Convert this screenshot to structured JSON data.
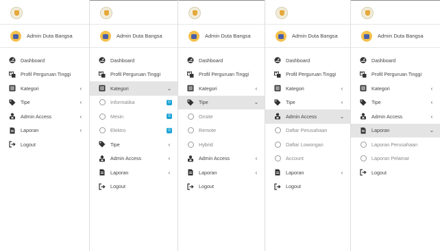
{
  "user": {
    "name": "Admin Duta Bangsa"
  },
  "labels": {
    "dashboard": "Dashboard",
    "profil": "Profil Perguruan Tinggi",
    "kategori": "Kategori",
    "tipe": "Tipe",
    "admin_access": "Admin Access",
    "laporan": "Laporan",
    "logout": "Logout",
    "informatika": "Informatika",
    "mesin": "Mesin",
    "elektro": "Elektro",
    "onsite": "Onsite",
    "remote": "Remote",
    "hybrid": "Hybrid",
    "daftar_perusahaan": "Daftar Perusahaan",
    "daftar_lowongan": "Daftar Lowongan",
    "account": "Account",
    "laporan_perusahaan": "Laporan Perusahaan",
    "laporan_pelamar": "Laporan Pelamar"
  },
  "badges": {
    "informatika": "0",
    "mesin": "0",
    "elektro": "0"
  },
  "icons": {
    "dashboard": "dashboard-icon",
    "profil": "building-icon",
    "kategori": "list-icon",
    "tipe": "tags-icon",
    "admin_access": "user-lock-icon",
    "laporan": "file-icon",
    "logout": "sign-out-icon"
  },
  "colors": {
    "accent": "#1ba3d6",
    "active_bg": "#e4e4e4"
  }
}
